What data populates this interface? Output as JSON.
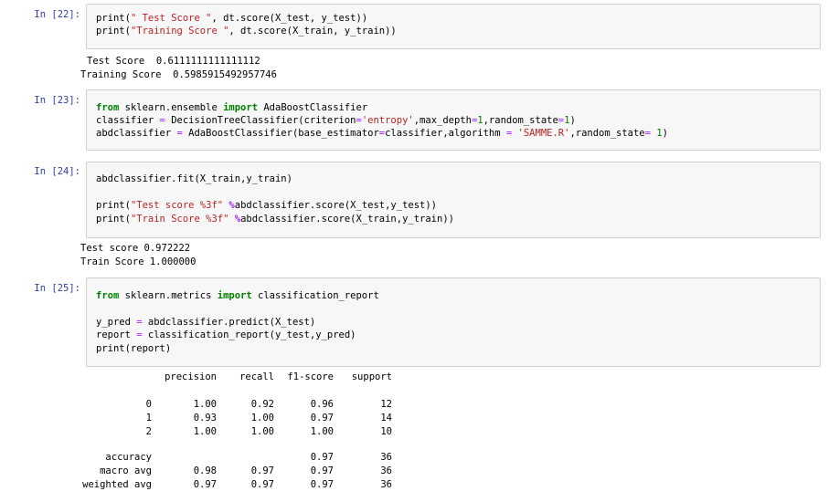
{
  "cells": [
    {
      "prompt": "In [22]:",
      "code": [
        [
          {
            "t": "print(\" Test Score \", dt.score(X_test, y_test))",
            "c": ""
          }
        ],
        [
          {
            "t": "print(\"Training Score \", dt.score(X_train, y_train))",
            "c": ""
          }
        ]
      ],
      "output": [
        "Test Score  0.6111111111111112",
        "Training Score  0.5985915492957746"
      ]
    },
    {
      "prompt": "In [23]:",
      "code_text": [
        "from sklearn.ensemble import AdaBoostClassifier",
        "classifier = DecisionTreeClassifier(criterion='entropy',max_depth=1,random_state=1)",
        "abdclassifier = AdaBoostClassifier(base_estimator=classifier,algorithm = 'SAMME.R',random_state= 1)"
      ]
    },
    {
      "prompt": "In [24]:",
      "code_text": [
        "abdclassifier.fit(X_train,y_train)",
        "",
        "print(\"Test score %3f\" %abdclassifier.score(X_test,y_test))",
        "print(\"Train Score %3f\" %abdclassifier.score(X_train,y_train))"
      ],
      "output": [
        "Test score 0.972222",
        "Train Score 1.000000"
      ]
    },
    {
      "prompt": "In [25]:",
      "code_text": [
        "from sklearn.metrics import classification_report",
        "",
        "y_pred = abdclassifier.predict(X_test)",
        "report = classification_report(y_test,y_pred)",
        "print(report)"
      ]
    }
  ],
  "report": {
    "headers": [
      "precision",
      "recall",
      "f1-score",
      "support"
    ],
    "rows": [
      {
        "label": "0",
        "precision": "1.00",
        "recall": "0.92",
        "f1": "0.96",
        "support": "12"
      },
      {
        "label": "1",
        "precision": "0.93",
        "recall": "1.00",
        "f1": "0.97",
        "support": "14"
      },
      {
        "label": "2",
        "precision": "1.00",
        "recall": "1.00",
        "f1": "1.00",
        "support": "10"
      }
    ],
    "summary": [
      {
        "label": "accuracy",
        "precision": "",
        "recall": "",
        "f1": "0.97",
        "support": "36"
      },
      {
        "label": "macro avg",
        "precision": "0.98",
        "recall": "0.97",
        "f1": "0.97",
        "support": "36"
      },
      {
        "label": "weighted avg",
        "precision": "0.97",
        "recall": "0.97",
        "f1": "0.97",
        "support": "36"
      }
    ]
  }
}
